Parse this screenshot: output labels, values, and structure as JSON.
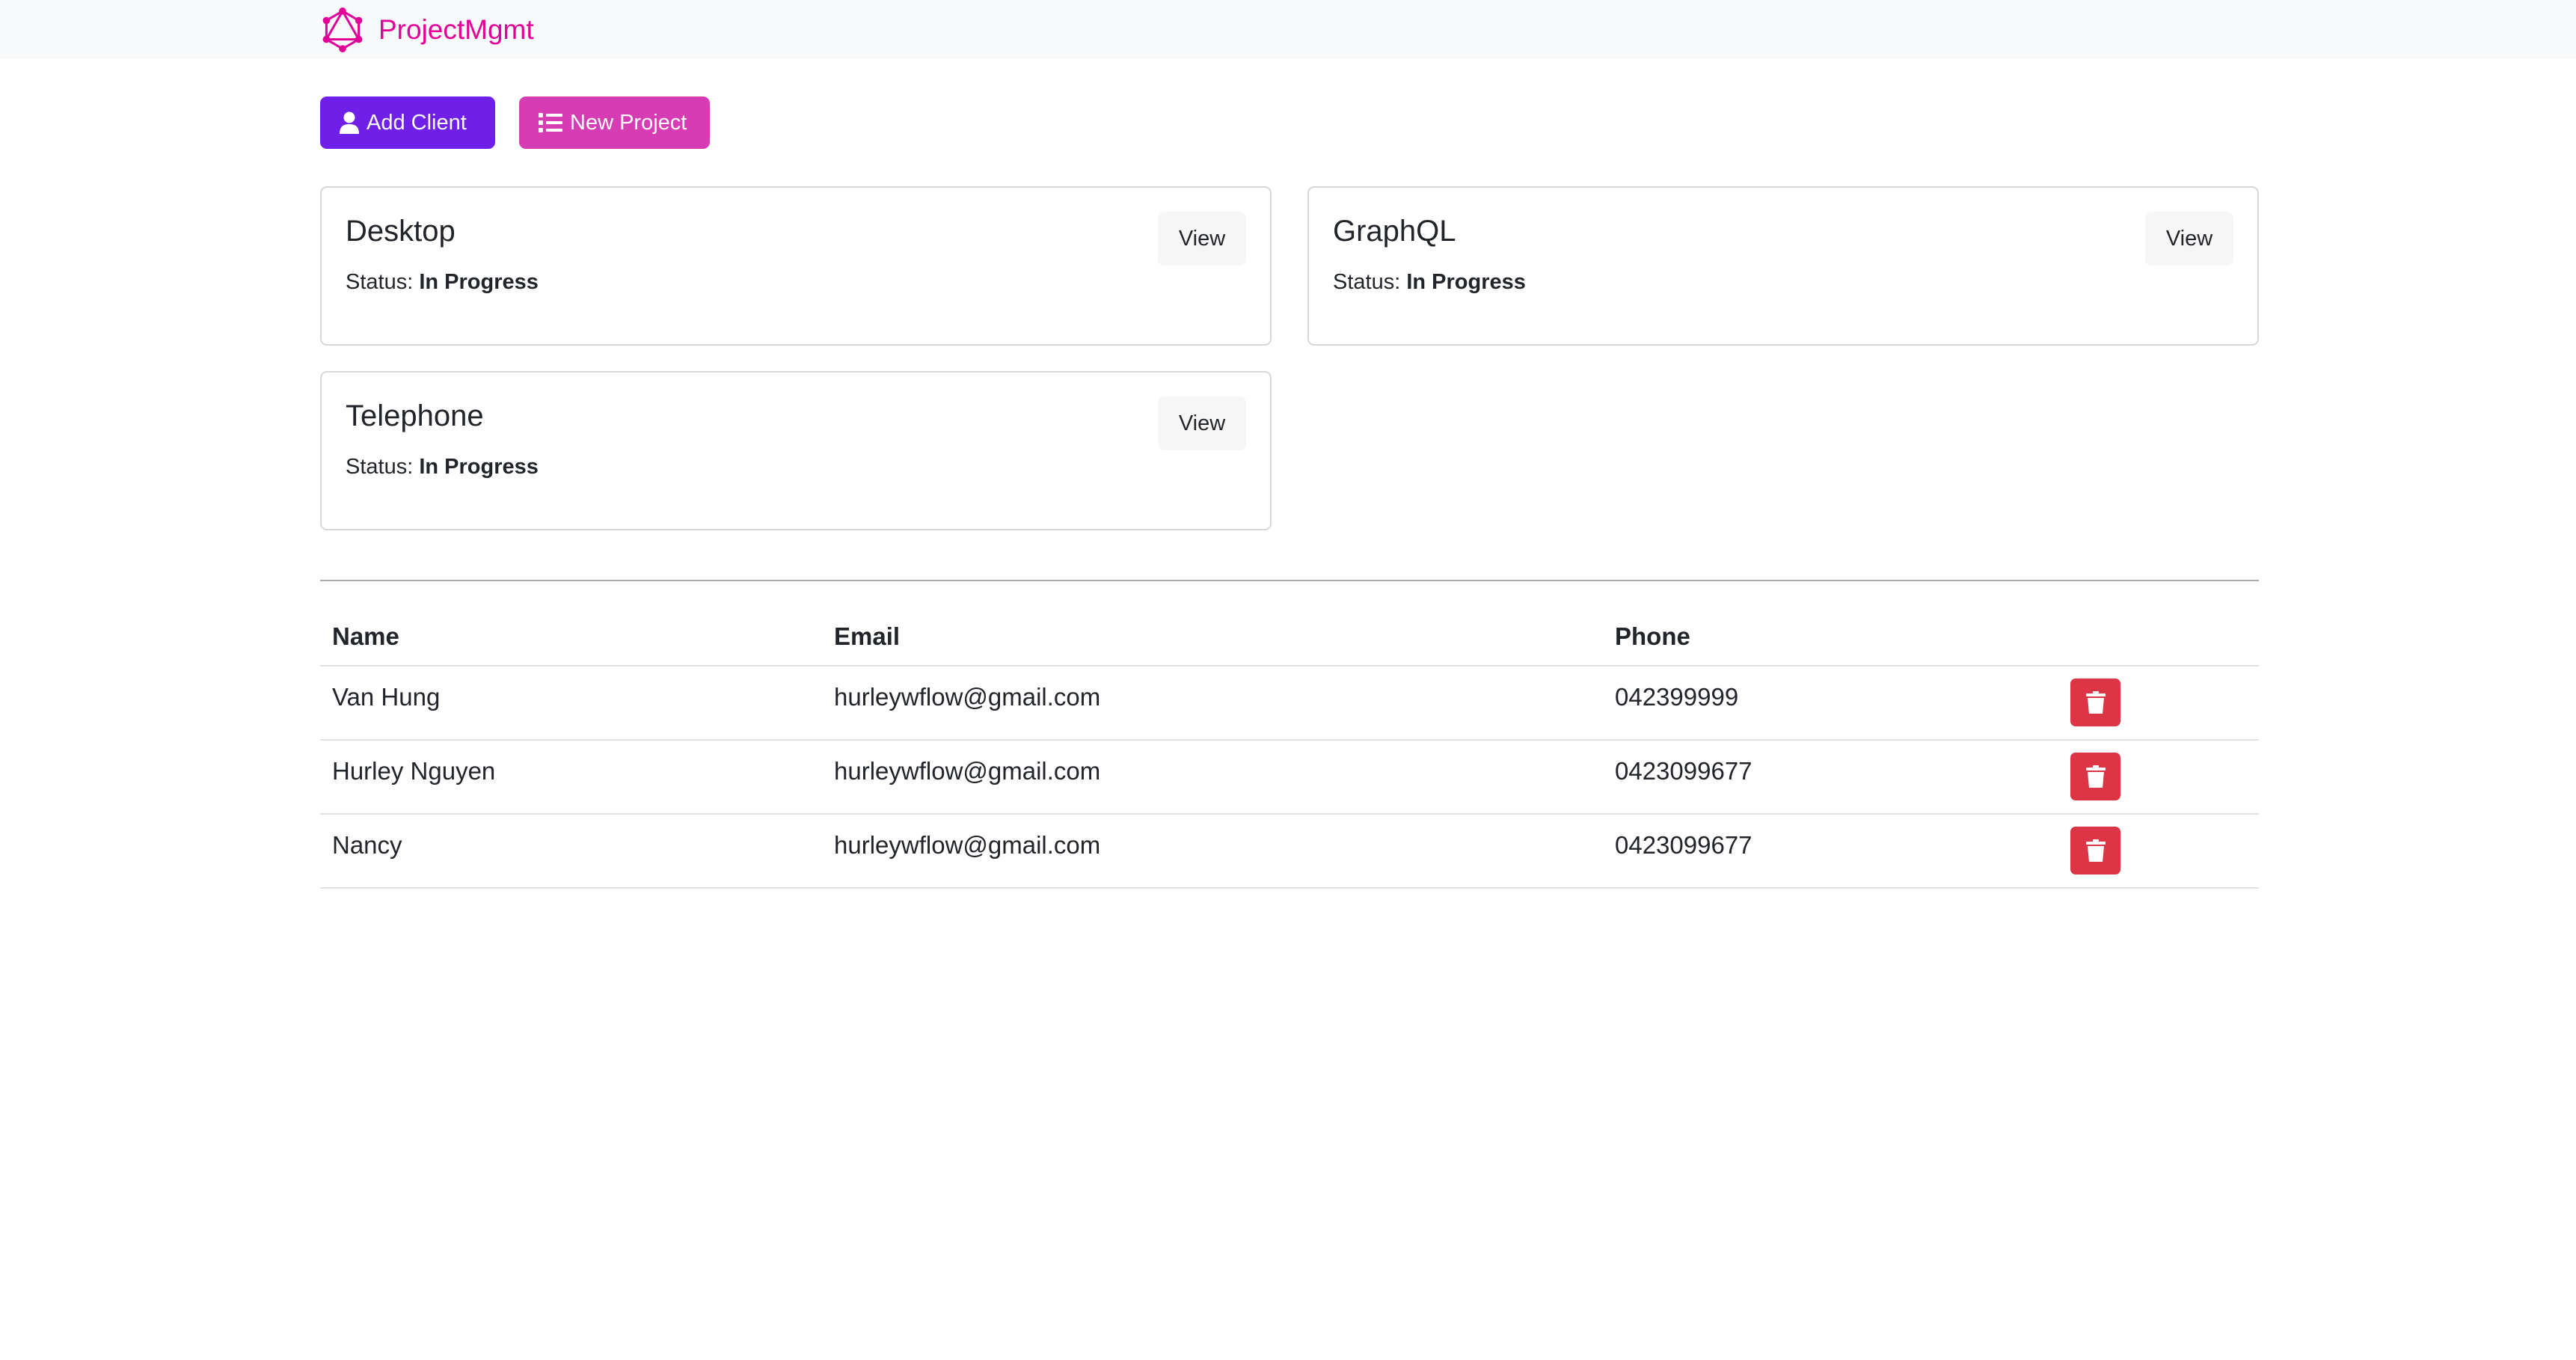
{
  "navbar": {
    "brand_text": "ProjectMgmt",
    "logo_icon": "graphql-logo-icon",
    "brand_color": "#e10098"
  },
  "actions": {
    "add_client_label": "Add Client",
    "add_client_icon": "user-icon",
    "new_project_label": "New Project",
    "new_project_icon": "list-icon"
  },
  "projects": [
    {
      "name": "Desktop",
      "status_label": "Status:",
      "status": "In Progress",
      "view_label": "View"
    },
    {
      "name": "GraphQL",
      "status_label": "Status:",
      "status": "In Progress",
      "view_label": "View"
    },
    {
      "name": "Telephone",
      "status_label": "Status:",
      "status": "In Progress",
      "view_label": "View"
    }
  ],
  "clients": {
    "headers": [
      "Name",
      "Email",
      "Phone"
    ],
    "rows": [
      {
        "name": "Van Hung",
        "email": "hurleywflow@gmail.com",
        "phone": "042399999"
      },
      {
        "name": "Hurley Nguyen",
        "email": "hurleywflow@gmail.com",
        "phone": "0423099677"
      },
      {
        "name": "Nancy",
        "email": "hurleywflow@gmail.com",
        "phone": "0423099677"
      }
    ],
    "delete_icon": "trash-icon"
  },
  "colors": {
    "add_client": "#6f1fe8",
    "new_project": "#d63cb4",
    "delete": "#dc3545",
    "navbar_bg": "#f8f9fa"
  }
}
